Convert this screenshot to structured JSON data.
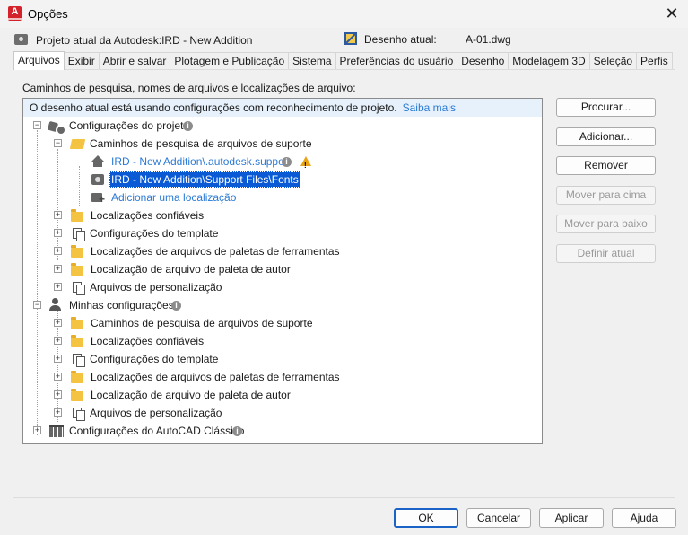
{
  "window": {
    "title": "Opções",
    "app_icon_letter": "A"
  },
  "info": {
    "project": "Projeto atual da Autodesk:IRD - New Addition",
    "drawing_label": "Desenho atual:",
    "drawing_value": "A-01.dwg"
  },
  "tabs": [
    "Arquivos",
    "Exibir",
    "Abrir e salvar",
    "Plotagem e Publicação",
    "Sistema",
    "Preferências do usuário",
    "Desenho",
    "Modelagem 3D",
    "Seleção",
    "Perfis"
  ],
  "panel": {
    "label": "Caminhos de pesquisa, nomes de arquivos e localizações de arquivo:",
    "banner_text": "O desenho atual está usando configurações com reconhecimento de projeto.",
    "banner_link": "Saiba mais"
  },
  "tree": {
    "project_settings": "Configurações do projeto",
    "support_paths": "Caminhos de pesquisa de arquivos de suporte",
    "path1": "IRD - New Addition\\.autodesk.support",
    "path2": "IRD - New Addition\\Support Files\\Fonts",
    "add_location": "Adicionar uma localização",
    "trusted": "Localizações confiáveis",
    "template": "Configurações do template",
    "tool_palettes": "Localizações de arquivos de paletas de ferramentas",
    "author_palette": "Localização de arquivo de paleta de autor",
    "customization": "Arquivos de personalização",
    "my_settings": "Minhas configurações",
    "classic": "Configurações do AutoCAD Clássico"
  },
  "side_buttons": {
    "browse": "Procurar...",
    "add": "Adicionar...",
    "remove": "Remover",
    "move_up": "Mover para cima",
    "move_down": "Mover para baixo",
    "set_current": "Definir atual"
  },
  "footer": {
    "ok": "OK",
    "cancel": "Cancelar",
    "apply": "Aplicar",
    "help": "Ajuda"
  },
  "colors": {
    "link": "#2a7ad6",
    "selection": "#0a5ad5",
    "banner": "#e6f1fb",
    "warning": "#e8a317"
  }
}
